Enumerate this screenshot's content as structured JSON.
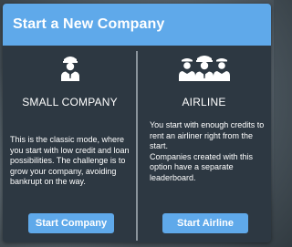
{
  "dialog": {
    "title": "Start a New Company",
    "colors": {
      "header": "#5fa9ea",
      "panel": "#2d3842",
      "button": "#5fa9ea",
      "text": "#ffffff"
    }
  },
  "options": [
    {
      "icon": "person-with-cap-icon",
      "title": "SMALL COMPANY",
      "description": "This is the classic mode, where you start with low credit and loan possibilities. The challenge is to grow your company, avoiding bankrupt on the way.",
      "button_label": "Start Company"
    },
    {
      "icon": "airline-crew-icon",
      "title": "AIRLINE",
      "description_lines": [
        "You start with enough credits to rent an airliner right from the start.",
        "Companies created with this option have a separate leaderboard."
      ],
      "button_label": "Start Airline"
    }
  ]
}
